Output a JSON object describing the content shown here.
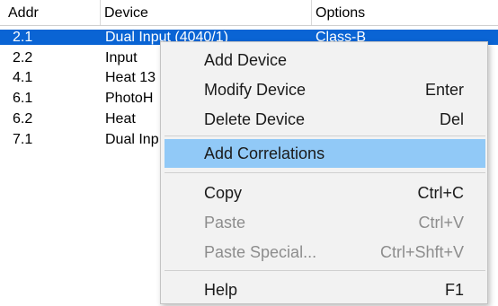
{
  "columns": {
    "addr": "Addr",
    "device": "Device",
    "options": "Options"
  },
  "rows": [
    {
      "addr": "2.1",
      "device": "Dual Input (4040/1)",
      "options": "Class-B",
      "selected": true
    },
    {
      "addr": "2.2",
      "device": "Input",
      "options": ""
    },
    {
      "addr": "4.1",
      "device": "Heat 13",
      "options": ""
    },
    {
      "addr": "6.1",
      "device": "PhotoH",
      "options": ""
    },
    {
      "addr": "6.2",
      "device": "Heat",
      "options": ""
    },
    {
      "addr": "7.1",
      "device": "Dual Inp",
      "options": ""
    }
  ],
  "context_menu": {
    "add_device": {
      "label": "Add Device",
      "shortcut": ""
    },
    "modify_device": {
      "label": "Modify Device",
      "shortcut": "Enter"
    },
    "delete_device": {
      "label": "Delete Device",
      "shortcut": "Del"
    },
    "add_correlations": {
      "label": "Add Correlations",
      "shortcut": ""
    },
    "copy": {
      "label": "Copy",
      "shortcut": "Ctrl+C"
    },
    "paste": {
      "label": "Paste",
      "shortcut": "Ctrl+V"
    },
    "paste_special": {
      "label": "Paste Special...",
      "shortcut": "Ctrl+Shft+V"
    },
    "help": {
      "label": "Help",
      "shortcut": "F1"
    }
  },
  "colors": {
    "selection": "#0a64d4",
    "menu_highlight": "#91c9f7",
    "menu_background": "#f2f2f2",
    "disabled_text": "#8d8d8d"
  }
}
